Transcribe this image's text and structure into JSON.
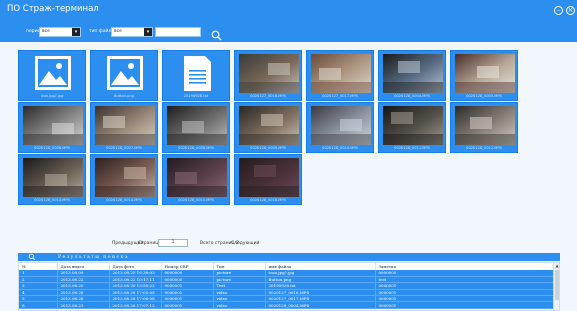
{
  "app": {
    "title": "ПО Страж-терминал"
  },
  "window": {
    "minimize_icon": "minimize-icon",
    "close_icon": "close-icon"
  },
  "filters": {
    "period_label": "период",
    "period_value": "все",
    "filetype_label": "тип файла",
    "filetype_value": "все",
    "search_value": "",
    "search_icon": "search-icon"
  },
  "gallery": {
    "items": [
      {
        "caption": "icon.jpg?.jpg",
        "kind": "image-icon"
      },
      {
        "caption": "Button.png",
        "kind": "image-icon"
      },
      {
        "caption": "20190928.txt",
        "kind": "document-icon"
      },
      {
        "caption": "0020127_0016.MP4",
        "kind": "video"
      },
      {
        "caption": "0020127_0017.MP4",
        "kind": "video"
      },
      {
        "caption": "0020128_0004.MP4",
        "kind": "video"
      },
      {
        "caption": "0020128_0005.MP4",
        "kind": "video"
      },
      {
        "caption": "0020128_0006.MP4",
        "kind": "video"
      },
      {
        "caption": "0020128_0007.MP4",
        "kind": "video"
      },
      {
        "caption": "0020128_0008.MP4",
        "kind": "video"
      },
      {
        "caption": "0020128_0009.MP4",
        "kind": "video"
      },
      {
        "caption": "0020128_0010.MP4",
        "kind": "video"
      },
      {
        "caption": "0020128_0011.MP4",
        "kind": "video"
      },
      {
        "caption": "0020128_0012.MP4",
        "kind": "video"
      },
      {
        "caption": "0020128_0013.MP4",
        "kind": "video"
      },
      {
        "caption": "0020128_0014.MP4",
        "kind": "video"
      },
      {
        "caption": "0020128_0015.MP4",
        "kind": "video"
      },
      {
        "caption": "0020128_0016.MP4",
        "kind": "video"
      }
    ]
  },
  "pager": {
    "prev_label": "Предыдущий",
    "page_label": "Страница",
    "page_value": "1",
    "total_label": "Всего страниц 2",
    "next_label": "Следующий"
  },
  "results": {
    "title": "Результаты поиска",
    "icon": "search-icon",
    "columns": [
      "№",
      "Дата видео",
      "Дата фото",
      "Номер СВР",
      "Тип",
      "имя файла",
      "Заметка"
    ],
    "rows": [
      [
        "1",
        "2013.08.09",
        "2013.08.25 16:38:03",
        "0000000",
        "picture",
        "icon.jpg?.jpg",
        "0000000"
      ],
      [
        "2",
        "2013.08.22",
        "2013.08.22 10:17:11",
        "0000000",
        "picture",
        "Button.png",
        "test"
      ],
      [
        "3",
        "2013.08.20",
        "2013.08.20 13:55:22",
        "0000001",
        "Text",
        "20190928.txt",
        "0000001"
      ],
      [
        "4",
        "2013.08.28",
        "2013.08.28 17:05:05",
        "0000001",
        "video",
        "0020127_0016.MP4",
        "0000001"
      ],
      [
        "5",
        "2013.08.28",
        "2013.08.28 17:06:08",
        "0000001",
        "video",
        "0020127_0017.MP4",
        "0000001"
      ],
      [
        "6",
        "2013.08.21",
        "2013.08.28 17:07:12",
        "0000001",
        "video",
        "0020128_0004.MP4",
        "0000001"
      ]
    ]
  },
  "colors": {
    "accent": "#2c8ff0",
    "background": "#f2f7fd"
  }
}
